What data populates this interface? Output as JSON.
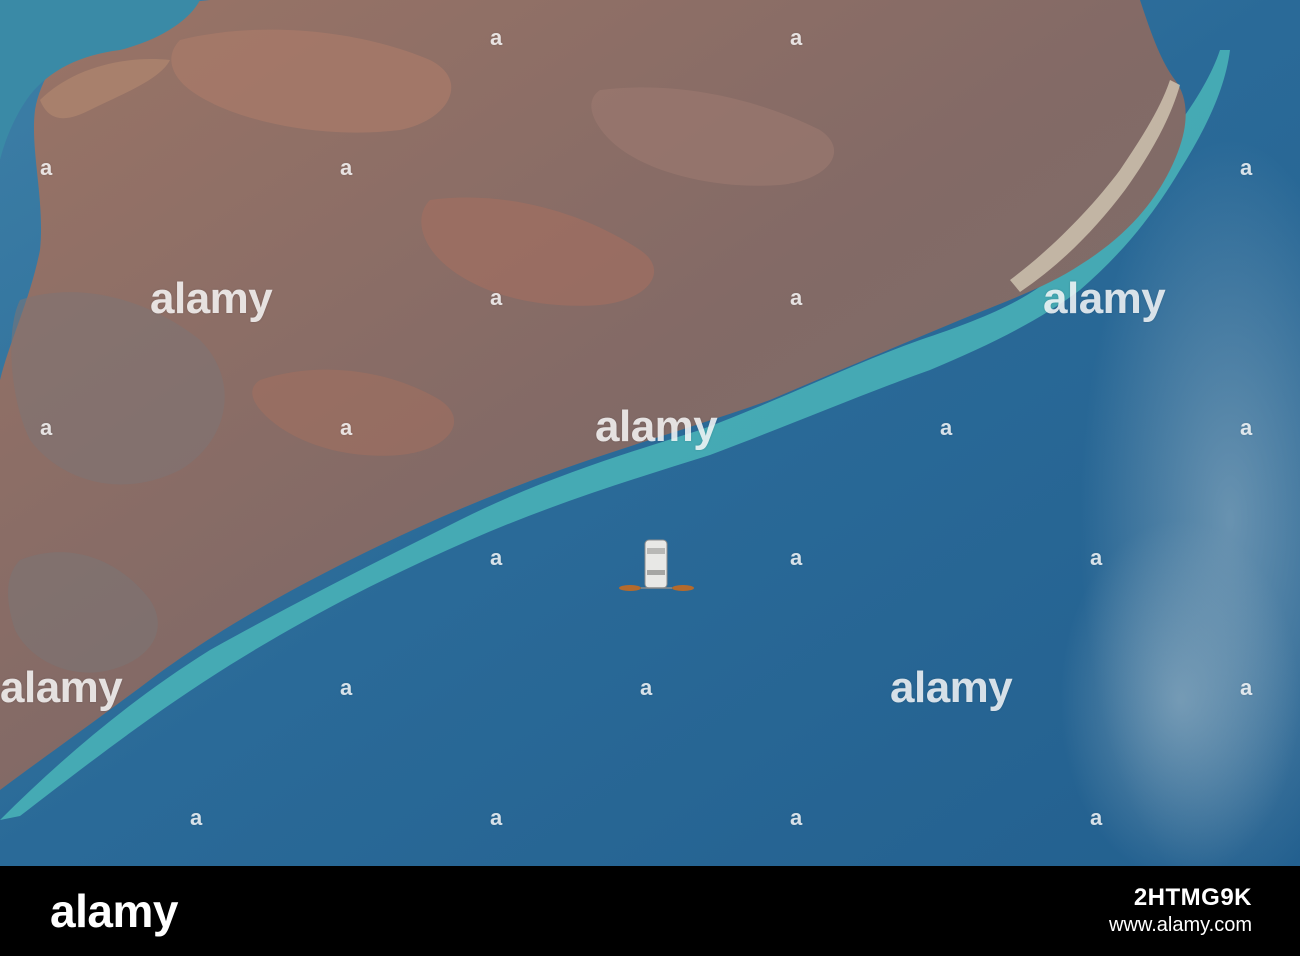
{
  "image": {
    "subject": "spacecraft-over-coastline"
  },
  "watermark": {
    "brand": "alamy",
    "small_mark": "a"
  },
  "footer": {
    "logo": "alamy",
    "image_id": "2HTMG9K",
    "url": "www.alamy.com"
  },
  "colors": {
    "ocean": "#2a6d9a",
    "land": "#8a6a62",
    "reef": "#4fc0c0",
    "footer": "#000000"
  }
}
